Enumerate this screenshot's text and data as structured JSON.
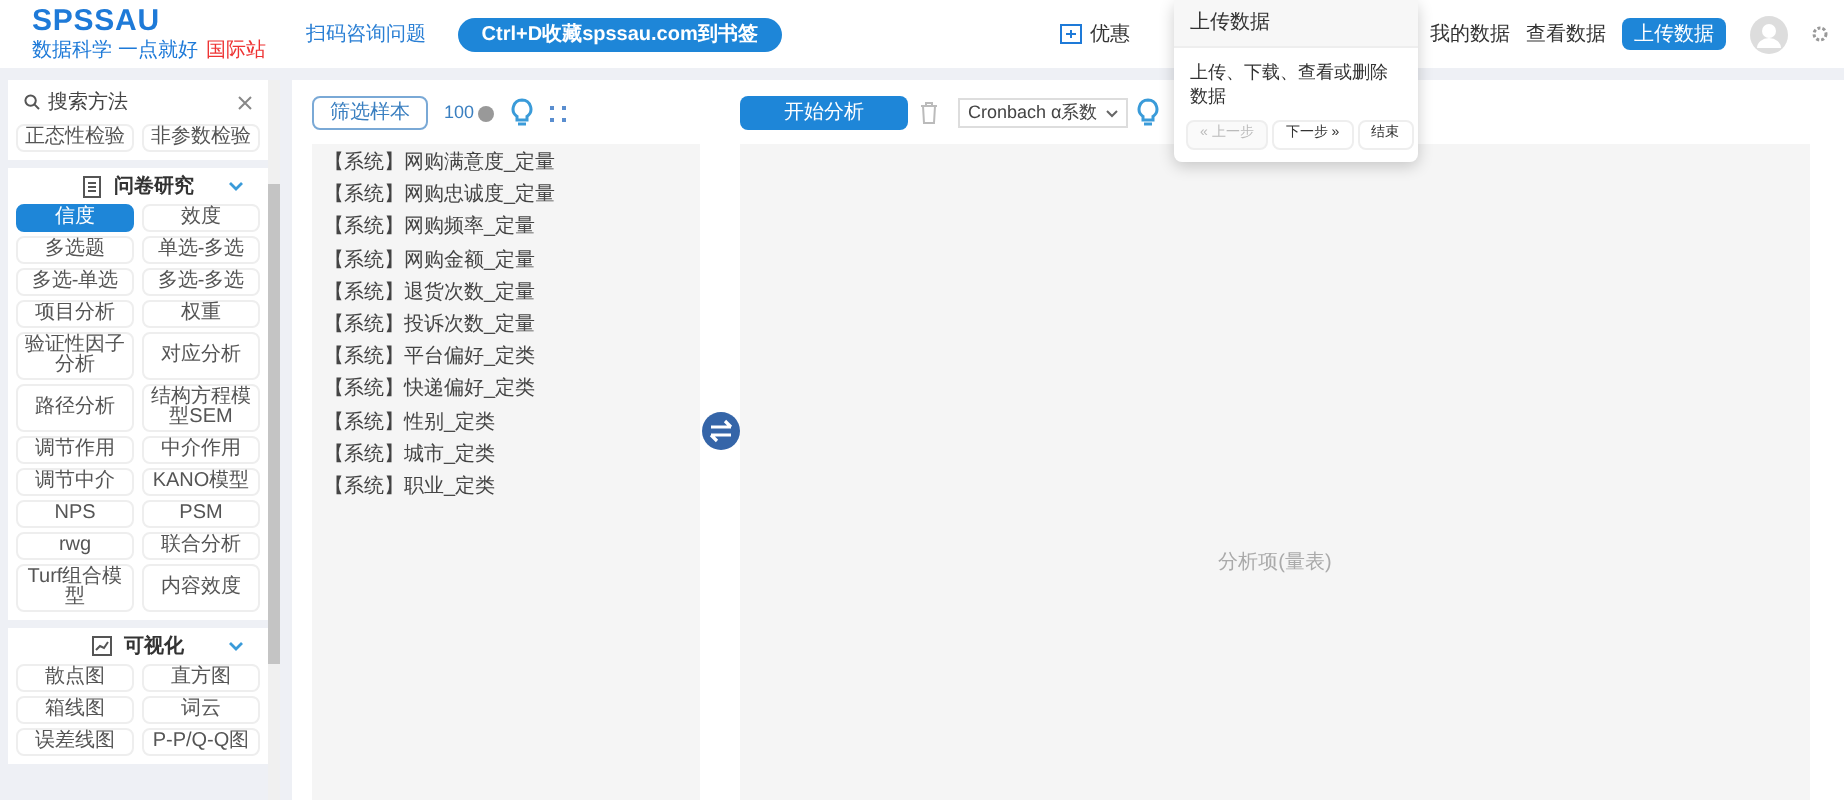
{
  "header": {
    "logo": {
      "title": "SPSSAU",
      "slogan": "数据科学 一点就好",
      "badge": "国际站"
    },
    "consult_link": "扫码咨询问题",
    "bookmark_pill": "Ctrl+D收藏spssau.com到书签",
    "promo_label": "优惠",
    "nav_links": [
      "我的数据",
      "查看数据"
    ],
    "upload_button": "上传数据"
  },
  "popover": {
    "title": "上传数据",
    "body": "上传、下载、查看或删除数据",
    "buttons": [
      {
        "label": "« 上一步",
        "disabled": true
      },
      {
        "label": "下一步 »",
        "disabled": false
      },
      {
        "label": "结束",
        "disabled": false
      }
    ]
  },
  "sidebar": {
    "search": {
      "placeholder": "搜索方法"
    },
    "sections": [
      {
        "items": [
          {
            "label": "正态性检验",
            "selected": false
          },
          {
            "label": "非参数检验",
            "selected": false
          }
        ]
      },
      {
        "title": "问卷研究",
        "expanded": true,
        "items": [
          {
            "label": "信度",
            "selected": true
          },
          {
            "label": "效度",
            "selected": false
          },
          {
            "label": "多选题",
            "selected": false
          },
          {
            "label": "单选-多选",
            "selected": false
          },
          {
            "label": "多选-单选",
            "selected": false
          },
          {
            "label": "多选-多选",
            "selected": false
          },
          {
            "label": "项目分析",
            "selected": false
          },
          {
            "label": "权重",
            "selected": false
          },
          {
            "label": "验证性因子分析",
            "selected": false
          },
          {
            "label": "对应分析",
            "selected": false
          },
          {
            "label": "路径分析",
            "selected": false
          },
          {
            "label": "结构方程模型SEM",
            "selected": false
          },
          {
            "label": "调节作用",
            "selected": false
          },
          {
            "label": "中介作用",
            "selected": false
          },
          {
            "label": "调节中介",
            "selected": false
          },
          {
            "label": "KANO模型",
            "selected": false
          },
          {
            "label": "NPS",
            "selected": false
          },
          {
            "label": "PSM",
            "selected": false
          },
          {
            "label": "rwg",
            "selected": false
          },
          {
            "label": "联合分析",
            "selected": false
          },
          {
            "label": "Turf组合模型",
            "selected": false
          },
          {
            "label": "内容效度",
            "selected": false
          }
        ]
      },
      {
        "title": "可视化",
        "expanded": true,
        "items": [
          {
            "label": "散点图",
            "selected": false
          },
          {
            "label": "直方图",
            "selected": false
          },
          {
            "label": "箱线图",
            "selected": false
          },
          {
            "label": "词云",
            "selected": false
          },
          {
            "label": "误差线图",
            "selected": false
          },
          {
            "label": "P-P/Q-Q图",
            "selected": false
          }
        ]
      }
    ]
  },
  "main": {
    "filter_button": "筛选样本",
    "sample_count": "100",
    "variables": [
      "【系统】网购满意度_定量",
      "【系统】网购忠诚度_定量",
      "【系统】网购频率_定量",
      "【系统】网购金额_定量",
      "【系统】退货次数_定量",
      "【系统】投诉次数_定量",
      "【系统】平台偏好_定类",
      "【系统】快递偏好_定类",
      "【系统】性别_定类",
      "【系统】城市_定类",
      "【系统】职业_定类"
    ],
    "start_button": "开始分析",
    "method_select": "Cronbach α系数",
    "analysis_placeholder": "分析项(量表)"
  }
}
